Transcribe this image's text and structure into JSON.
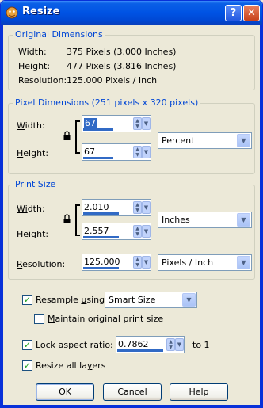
{
  "window": {
    "title": "Resize",
    "help": "?",
    "close": "✕"
  },
  "original": {
    "title": "Original Dimensions",
    "width_label": "Width:",
    "width_value": "375 Pixels (3.000 Inches)",
    "height_label": "Height:",
    "height_value": "477 Pixels (3.816 Inches)",
    "resolution_label": "Resolution:",
    "resolution_value": "125.000 Pixels / Inch"
  },
  "pixel": {
    "title": "Pixel Dimensions (251 pixels x 320 pixels)",
    "width_label_u": "W",
    "width_label_rest": "idth:",
    "height_label_u": "H",
    "height_label_rest": "eight:",
    "width_value": "67",
    "height_value": "67",
    "units": "Percent"
  },
  "print": {
    "title": "Print Size",
    "width_label_u": "Wi",
    "width_label_rest": "dth:",
    "height_label_u": "Hei",
    "height_label_rest": "ght:",
    "res_label_u": "R",
    "res_label_rest": "esolution:",
    "width_value": "2.010",
    "height_value": "2.557",
    "resolution_value": "125.000",
    "units": "Inches",
    "res_units": "Pixels / Inch"
  },
  "options": {
    "resample_label_pre": "Resample ",
    "resample_label_u": "u",
    "resample_label_post": "sing:",
    "resample_checked": true,
    "resample_method": "Smart Size",
    "maintain_label_u": "M",
    "maintain_label_rest": "aintain original print size",
    "maintain_checked": false,
    "lock_label_pre": "Lock ",
    "lock_label_u": "a",
    "lock_label_post": "spect ratio:",
    "lock_checked": true,
    "ratio_value": "0.7862",
    "ratio_suffix": "to 1",
    "resize_layers_label_pre": "Resize all la",
    "resize_layers_label_u": "y",
    "resize_layers_label_post": "ers",
    "resize_layers_checked": true
  },
  "buttons": {
    "ok": "OK",
    "cancel": "Cancel",
    "help": "Help"
  },
  "colors": {
    "titlebar": "#0053e4",
    "group_title": "#0046d5",
    "selection": "#316ac5"
  }
}
